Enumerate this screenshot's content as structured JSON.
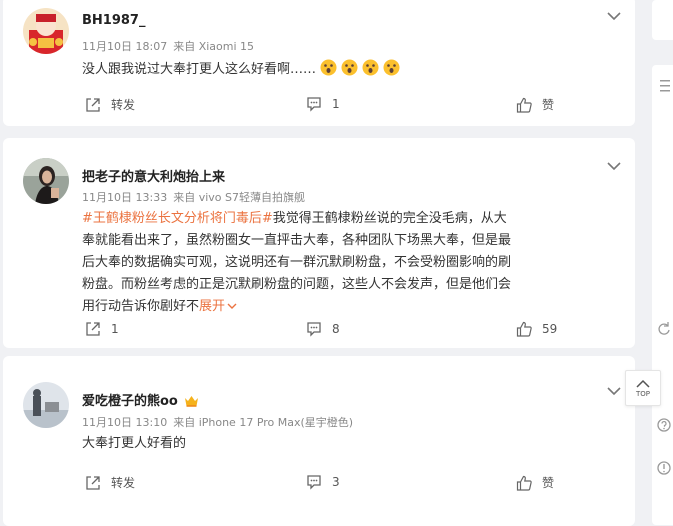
{
  "colors": {
    "accent": "#eb7340",
    "icon": "#888888",
    "background": "#f0f1f4"
  },
  "posts": [
    {
      "author": "BH1987_",
      "time": "11月10日 18:07",
      "source": "来自 Xiaomi 15",
      "text": "没人跟我说过大奉打更人这么好看啊……",
      "emoji": "surprised-face-emoji",
      "share_label": "转发",
      "comment_count": "1",
      "like_label": "赞"
    },
    {
      "author": "把老子的意大利炮抬上来",
      "time": "11月10日 13:33",
      "source": "来自 vivo S7轻薄自拍旗舰",
      "tag": "#王鹤棣粉丝长文分析将门毒后#",
      "text": "我觉得王鹤棣粉丝说的完全没毛病，从大奉就能看出来了，虽然粉圈女一直抨击大奉，各种团队下场黑大奉，但是最后大奉的数据确实可观，这说明还有一群沉默刷粉盘，不会受粉圈影响的刷粉盘。而粉丝考虑的正是沉默刷粉盘的问题，这些人不会发声，但是他们会用行动告诉你剧好不",
      "expand": "展开",
      "share_count": "1",
      "comment_count": "8",
      "like_count": "59"
    },
    {
      "author": "爱吃橙子的熊oo",
      "time": "11月10日 13:10",
      "source": "来自 iPhone 17 Pro Max(星宇橙色)",
      "text": "大奉打更人好看的",
      "share_label": "转发",
      "comment_count": "3",
      "like_label": "赞"
    }
  ],
  "to_top_label": "TOP"
}
